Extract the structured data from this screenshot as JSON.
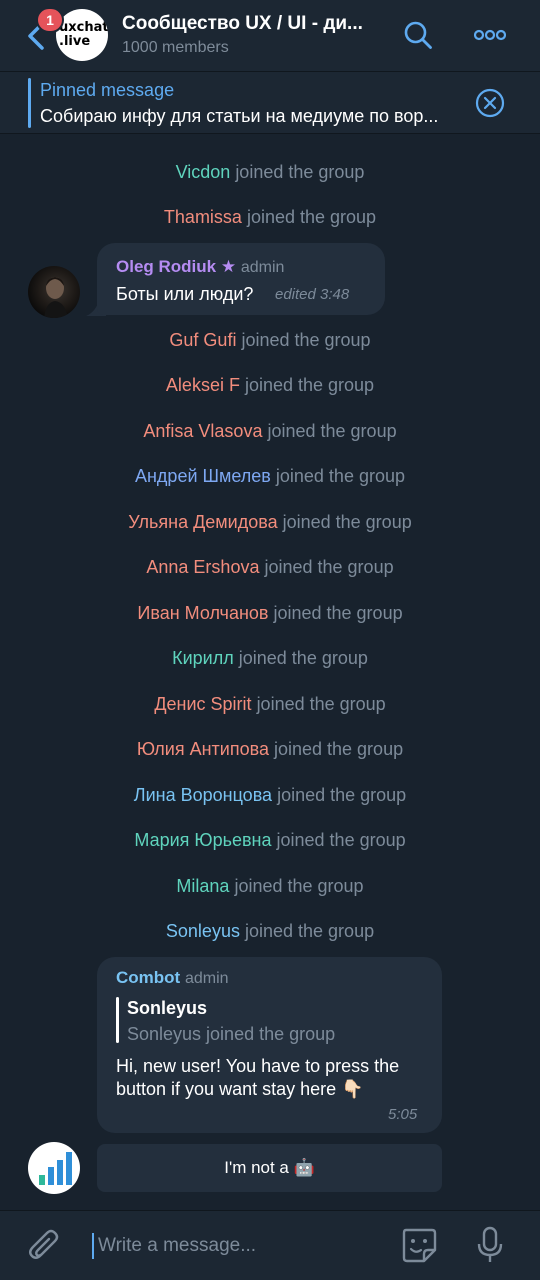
{
  "header": {
    "badge_count": "1",
    "group_logo_text_line1": "uxchat",
    "group_logo_text_line2": ".live",
    "title": "Сообщество UX / UI - ди...",
    "subtitle": "1000 members",
    "accent_color": "#5eaaf0"
  },
  "pinned": {
    "title": "Pinned message",
    "text": "Собираю инфу для статьи на медиуме по вор..."
  },
  "joined_text": "joined the group",
  "joins": [
    {
      "name": "Vicdon",
      "color": "#5fd4bd"
    },
    {
      "name": "Thamissa",
      "color": "#f28d7d"
    },
    {
      "name": "Guf Gufi",
      "color": "#f28d7d"
    },
    {
      "name": "Aleksei F",
      "color": "#f28d7d"
    },
    {
      "name": "Anfisa Vlasova",
      "color": "#f28d7d"
    },
    {
      "name": "Андрей Шмелев",
      "color": "#7ea8f2"
    },
    {
      "name": "Ульяна Демидова",
      "color": "#f28d7d"
    },
    {
      "name": "Anna Ershova",
      "color": "#f28d7d"
    },
    {
      "name": "Иван Молчанов",
      "color": "#f28d7d"
    },
    {
      "name": "Кирилл",
      "color": "#5fd4bd"
    },
    {
      "name": "Денис Spirit",
      "color": "#f28d7d"
    },
    {
      "name": "Юлия Антипова",
      "color": "#f28d7d"
    },
    {
      "name": "Лина Воронцова",
      "color": "#79c3f2"
    },
    {
      "name": "Мария Юрьевна",
      "color": "#5fd4bd"
    },
    {
      "name": "Milana",
      "color": "#5fd4bd"
    },
    {
      "name": "Sonleyus",
      "color": "#79c3f2"
    }
  ],
  "message1": {
    "sender": "Oleg Rodiuk",
    "sender_color": "#b58cf2",
    "star": "★",
    "role": "admin",
    "text": "Боты или люди?",
    "meta": "edited  3:48"
  },
  "message2": {
    "sender": "Combot",
    "sender_color": "#79c3f2",
    "role": "admin",
    "quote_title": "Sonleyus",
    "quote_text": "Sonleyus joined the group",
    "text": "Hi, new user! You have to press the button if you want stay here 👇🏻",
    "time": "5:05"
  },
  "inline_button": {
    "label": "I'm not a 🤖"
  },
  "input": {
    "placeholder": "Write a message..."
  }
}
